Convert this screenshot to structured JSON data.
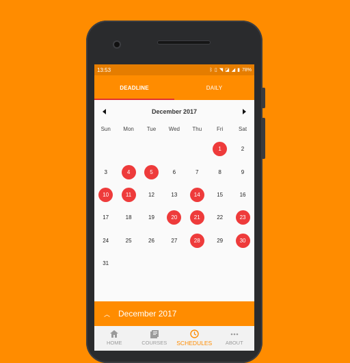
{
  "colors": {
    "background": "#FF8C00",
    "accent": "#FF8C00",
    "highlight": "#EE3B3B",
    "statusbar": "#E57D00"
  },
  "statusbar": {
    "time": "13:53",
    "battery": "78%"
  },
  "tabs": [
    {
      "label": "DEADLINE",
      "active": true
    },
    {
      "label": "DAILY",
      "active": false
    }
  ],
  "calendar": {
    "month_label": "December 2017",
    "weekdays": [
      "Sun",
      "Mon",
      "Tue",
      "Wed",
      "Thu",
      "Fri",
      "Sat"
    ],
    "first_weekday_index": 5,
    "days_in_month": 31,
    "highlighted_days": [
      1,
      4,
      5,
      10,
      11,
      14,
      20,
      21,
      23,
      28,
      30
    ]
  },
  "month_bar": {
    "label": "December 2017"
  },
  "bottom_nav": [
    {
      "label": "HOME",
      "icon": "home-icon",
      "active": false
    },
    {
      "label": "COURSES",
      "icon": "book-icon",
      "active": false
    },
    {
      "label": "SCHEDULES",
      "icon": "clock-icon",
      "active": true
    },
    {
      "label": "ABOUT",
      "icon": "more-icon",
      "active": false
    }
  ]
}
